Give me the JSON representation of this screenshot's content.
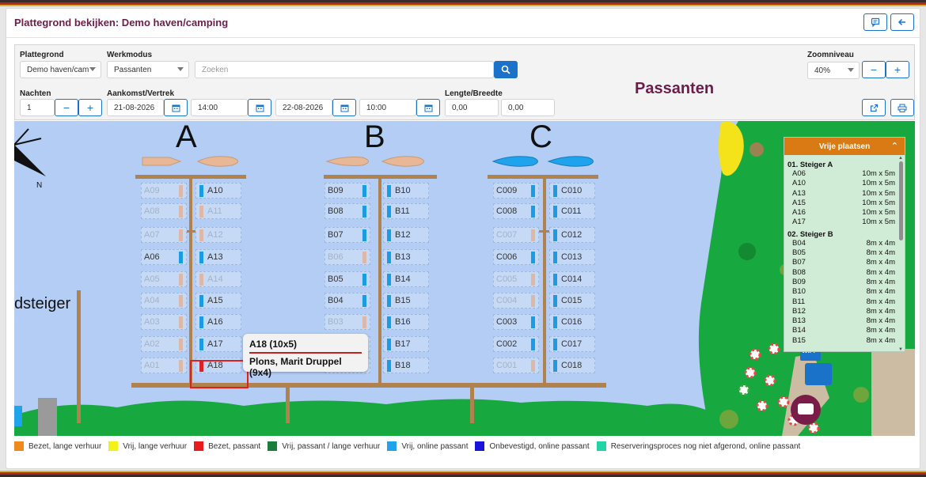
{
  "header": {
    "title": "Plattegrond bekijken: Demo haven/camping",
    "comment_icon": "comment-icon",
    "back_icon": "arrow-left-icon"
  },
  "controls": {
    "plattegrond_label": "Plattegrond",
    "plattegrond_value": "Demo haven/cam",
    "werkmodus_label": "Werkmodus",
    "werkmodus_value": "Passanten",
    "search_placeholder": "Zoeken",
    "zoom_label": "Zoomniveau",
    "zoom_value": "40%",
    "mode_heading": "Passanten",
    "nachten_label": "Nachten",
    "nachten_value": "1",
    "aankomst_label": "Aankomst/Vertrek",
    "arrival_date": "21-08-2026",
    "arrival_time": "14:00",
    "departure_date": "22-08-2026",
    "departure_time": "10:00",
    "lengte_label": "Lengte/Breedte",
    "lengte_value": "0,00",
    "breedte_value": "0,00",
    "minus": "−",
    "plus": "+"
  },
  "map": {
    "pier_a": "A",
    "pier_b": "B",
    "pier_c": "C",
    "pier_side_label": "dsteiger",
    "compass_n": "N",
    "wifi": "WiFi",
    "berths_a_left": [
      {
        "id": "A09",
        "status": "free"
      },
      {
        "id": "A08",
        "status": "free"
      },
      {
        "id": "A07",
        "status": "free"
      },
      {
        "id": "A06",
        "status": "avail"
      },
      {
        "id": "A05",
        "status": "free"
      },
      {
        "id": "A04",
        "status": "free"
      },
      {
        "id": "A03",
        "status": "free"
      },
      {
        "id": "A02",
        "status": "free"
      },
      {
        "id": "A01",
        "status": "free"
      }
    ],
    "berths_a_right": [
      {
        "id": "A10",
        "status": "avail"
      },
      {
        "id": "A11",
        "status": "free"
      },
      {
        "id": "A12",
        "status": "free"
      },
      {
        "id": "A13",
        "status": "avail"
      },
      {
        "id": "A14",
        "status": "free"
      },
      {
        "id": "A15",
        "status": "avail"
      },
      {
        "id": "A16",
        "status": "avail"
      },
      {
        "id": "A17",
        "status": "avail"
      },
      {
        "id": "A18",
        "status": "busy"
      }
    ],
    "berths_b_left": [
      {
        "id": "B09",
        "status": "avail"
      },
      {
        "id": "B08",
        "status": "avail"
      },
      {
        "id": "B07",
        "status": "avail"
      },
      {
        "id": "B06",
        "status": "free"
      },
      {
        "id": "B05",
        "status": "avail"
      },
      {
        "id": "B04",
        "status": "avail"
      },
      {
        "id": "B03",
        "status": "free"
      },
      {
        "id": "B02",
        "status": "free"
      },
      {
        "id": "B01",
        "status": "free"
      }
    ],
    "berths_b_right": [
      {
        "id": "B10",
        "status": "avail"
      },
      {
        "id": "B11",
        "status": "avail"
      },
      {
        "id": "B12",
        "status": "avail"
      },
      {
        "id": "B13",
        "status": "avail"
      },
      {
        "id": "B14",
        "status": "avail"
      },
      {
        "id": "B15",
        "status": "avail"
      },
      {
        "id": "B16",
        "status": "avail"
      },
      {
        "id": "B17",
        "status": "avail"
      },
      {
        "id": "B18",
        "status": "avail"
      }
    ],
    "berths_c_left": [
      {
        "id": "C009",
        "status": "avail"
      },
      {
        "id": "C008",
        "status": "avail"
      },
      {
        "id": "C007",
        "status": "free"
      },
      {
        "id": "C006",
        "status": "avail"
      },
      {
        "id": "C005",
        "status": "free"
      },
      {
        "id": "C004",
        "status": "free"
      },
      {
        "id": "C003",
        "status": "avail"
      },
      {
        "id": "C002",
        "status": "avail"
      },
      {
        "id": "C001",
        "status": "free"
      }
    ],
    "berths_c_right": [
      {
        "id": "C010",
        "status": "avail"
      },
      {
        "id": "C011",
        "status": "avail"
      },
      {
        "id": "C012",
        "status": "avail"
      },
      {
        "id": "C013",
        "status": "avail"
      },
      {
        "id": "C014",
        "status": "avail"
      },
      {
        "id": "C015",
        "status": "avail"
      },
      {
        "id": "C016",
        "status": "avail"
      },
      {
        "id": "C017",
        "status": "avail"
      },
      {
        "id": "C018",
        "status": "avail"
      }
    ],
    "tooltip": {
      "line1": "A18 (10x5)",
      "line2": "Plons, Marit Druppel (9x4)"
    }
  },
  "vrije_plaatsen": {
    "title": "Vrije plaatsen",
    "groups": [
      {
        "name": "01. Steiger A",
        "rows": [
          {
            "id": "A06",
            "size": "10m x 5m"
          },
          {
            "id": "A10",
            "size": "10m x 5m"
          },
          {
            "id": "A13",
            "size": "10m x 5m"
          },
          {
            "id": "A15",
            "size": "10m x 5m"
          },
          {
            "id": "A16",
            "size": "10m x 5m"
          },
          {
            "id": "A17",
            "size": "10m x 5m"
          }
        ]
      },
      {
        "name": "02. Steiger B",
        "rows": [
          {
            "id": "B04",
            "size": "8m x 4m"
          },
          {
            "id": "B05",
            "size": "8m x 4m"
          },
          {
            "id": "B07",
            "size": "8m x 4m"
          },
          {
            "id": "B08",
            "size": "8m x 4m"
          },
          {
            "id": "B09",
            "size": "8m x 4m"
          },
          {
            "id": "B10",
            "size": "8m x 4m"
          },
          {
            "id": "B11",
            "size": "8m x 4m"
          },
          {
            "id": "B12",
            "size": "8m x 4m"
          },
          {
            "id": "B13",
            "size": "8m x 4m"
          },
          {
            "id": "B14",
            "size": "8m x 4m"
          },
          {
            "id": "B15",
            "size": "8m x 4m"
          }
        ]
      }
    ]
  },
  "legend": [
    {
      "label": "Bezet, lange verhuur",
      "color": "#f08a1c"
    },
    {
      "label": "Vrij, lange verhuur",
      "color": "#f2f21a"
    },
    {
      "label": "Bezet, passant",
      "color": "#e81c1c"
    },
    {
      "label": "Vrij, passant / lange verhuur",
      "color": "#1b7d3a"
    },
    {
      "label": "Vrij, online passant",
      "color": "#1ea3ec"
    },
    {
      "label": "Onbevestigd, online passant",
      "color": "#1a14d8"
    },
    {
      "label": "Reserveringsproces nog niet afgerond, online passant",
      "color": "#22d3a6"
    }
  ]
}
